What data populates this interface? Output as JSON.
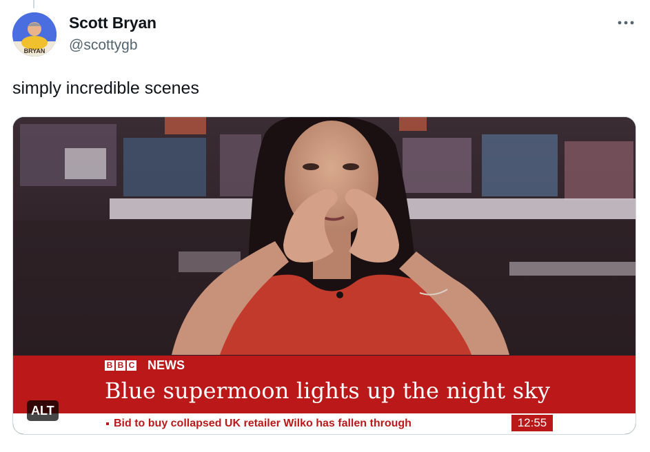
{
  "tweet": {
    "author": {
      "name": "Scott Bryan",
      "handle": "@scottygb",
      "avatar_caption": "BRYAN"
    },
    "text": "simply incredible scenes",
    "more_icon": "more-horizontal-icon"
  },
  "media": {
    "alt_badge": "ALT",
    "broadcast": {
      "brand_letters": [
        "B",
        "B",
        "C"
      ],
      "brand_word": "NEWS",
      "headline": "Blue supermoon lights up the night sky",
      "ticker": "Bid to buy collapsed UK retailer Wilko has fallen through",
      "clock": "12:55",
      "accent_color": "#bb1919"
    }
  }
}
